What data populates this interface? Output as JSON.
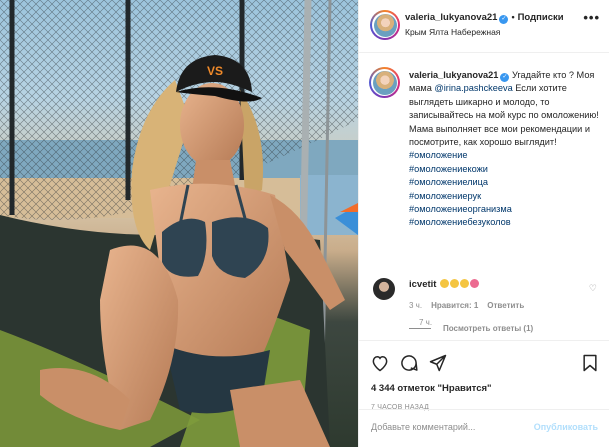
{
  "post": {
    "username": "valeria_lukyanova21",
    "follow_label": "Подписки",
    "dot": "•",
    "location": "Крым Ялта Набережная",
    "more_label": "•••",
    "caption": {
      "prefix": "Угадайте кто ? Моя мама",
      "mention": "@irina.pashckeeva",
      "text": "Если хотите выглядеть шикарно и молодо, то записывайтесь на мой курс по омоложению! Мама выполняет все мои рекомендации и посмотрите, как хорошо выглядит!",
      "hashtags": [
        "#омоложение",
        "#омоложениекожи",
        "#омоложениелица",
        "#омоложениерук",
        "#омоложениеорганизма",
        "#омоложениебезуколов"
      ],
      "time": "7 ч."
    },
    "comment": {
      "username": "icvetit",
      "time": "3 ч.",
      "likes": "Нравится: 1",
      "reply": "Ответить",
      "view_replies": "Посмотреть ответы (1)"
    },
    "likes_text": "4 344 отметок \"Нравится\"",
    "time_ago": "7 ЧАСОВ НАЗАД",
    "add_comment": {
      "placeholder": "Добавьте комментарий...",
      "post_label": "Опубликовать"
    }
  },
  "icons": [
    "heart-icon",
    "comment-icon",
    "share-icon",
    "bookmark-icon",
    "verified-icon",
    "more-icon"
  ],
  "colors": {
    "link": "#00376b",
    "verified": "#3897f0",
    "muted": "#8e8e8e",
    "post_disabled": "#b2dffc"
  }
}
